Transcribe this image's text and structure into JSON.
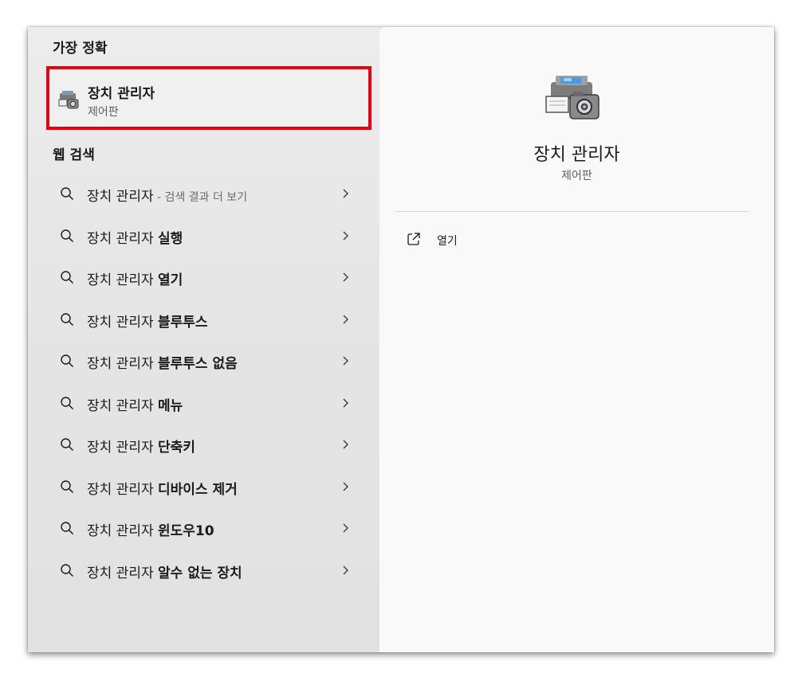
{
  "left": {
    "best_match_header": "가장 정확",
    "best_match": {
      "title": "장치 관리자",
      "subtitle": "제어판",
      "icon": "device-manager-icon"
    },
    "web_search_header": "웹 검색",
    "suggestions": [
      {
        "query": "장치 관리자",
        "bold": "",
        "suffix": " - 검색 결과 더 보기"
      },
      {
        "query": "장치 관리자 ",
        "bold": "실행",
        "suffix": ""
      },
      {
        "query": "장치 관리자 ",
        "bold": "열기",
        "suffix": ""
      },
      {
        "query": "장치 관리자 ",
        "bold": "블루투스",
        "suffix": ""
      },
      {
        "query": "장치 관리자 ",
        "bold": "블루투스 없음",
        "suffix": ""
      },
      {
        "query": "장치 관리자 ",
        "bold": "메뉴",
        "suffix": ""
      },
      {
        "query": "장치 관리자 ",
        "bold": "단축키",
        "suffix": ""
      },
      {
        "query": "장치 관리자 ",
        "bold": "디바이스 제거",
        "suffix": ""
      },
      {
        "query": "장치 관리자 ",
        "bold": "윈도우10",
        "suffix": ""
      },
      {
        "query": "장치 관리자 ",
        "bold": "알수 없는 장치",
        "suffix": ""
      }
    ]
  },
  "preview": {
    "title": "장치 관리자",
    "subtitle": "제어판",
    "actions": [
      {
        "label": "열기",
        "icon": "open-external-icon"
      }
    ]
  },
  "colors": {
    "highlight_border": "#e60012",
    "left_bg": "#e6e6e6",
    "right_bg": "#f9f9f9"
  }
}
